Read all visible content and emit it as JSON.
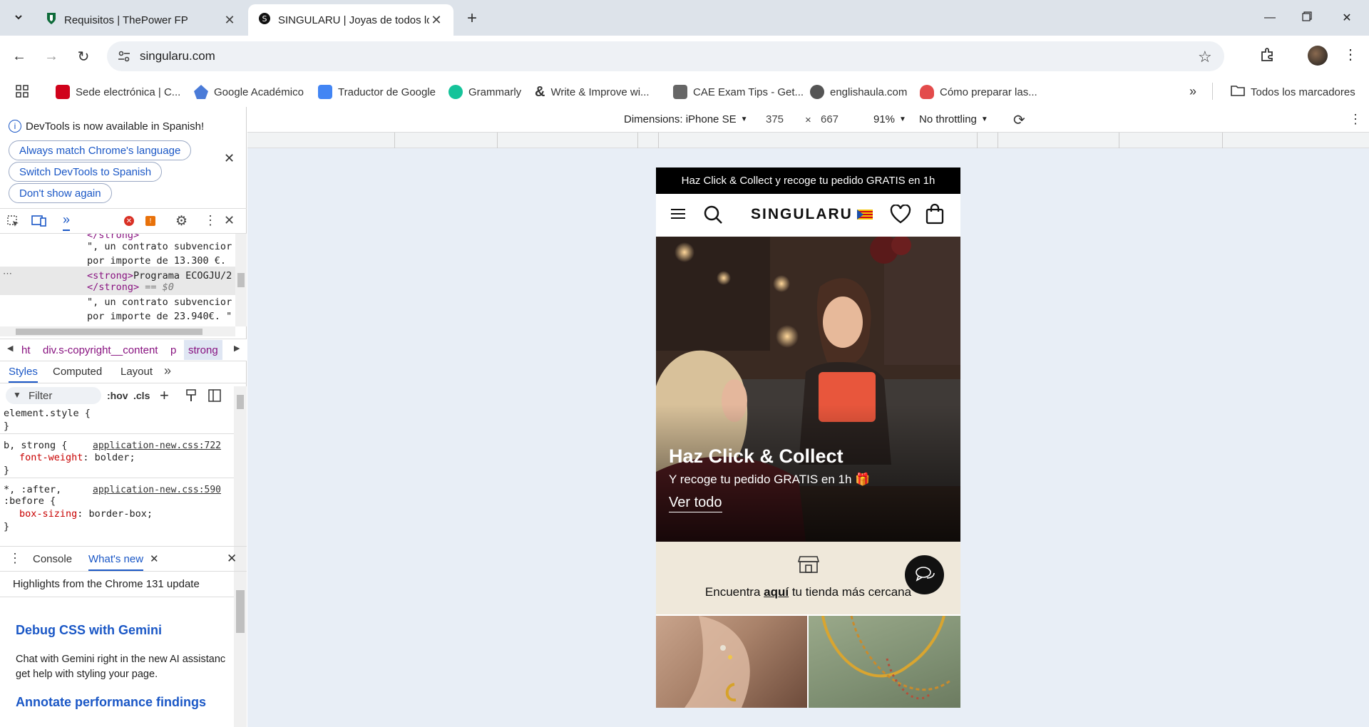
{
  "browser": {
    "tabs": [
      {
        "title": "Requisitos | ThePower FP",
        "active": false
      },
      {
        "title": "SINGULARU | Joyas de todos los estilos",
        "active": true
      }
    ],
    "url": "singularu.com",
    "bookmarks": [
      {
        "label": "Sede electrónica | C...",
        "icon": "madrid-icon",
        "color": "#d0021b"
      },
      {
        "label": "Google Académico",
        "icon": "scholar-icon",
        "color": "#4a7bd8"
      },
      {
        "label": "Traductor de Google",
        "icon": "translate-icon",
        "color": "#4285f4"
      },
      {
        "label": "Grammarly",
        "icon": "grammarly-icon",
        "color": "#15c39a"
      },
      {
        "label": "Write & Improve wi...",
        "icon": "ampersand-icon",
        "color": "#111111"
      },
      {
        "label": "CAE Exam Tips - Get...",
        "icon": "cae-icon",
        "color": "#666666"
      },
      {
        "label": "englishaula.com",
        "icon": "globe-icon",
        "color": "#555555"
      },
      {
        "label": "Cómo preparar las...",
        "icon": "elephant-icon",
        "color": "#e34b4b"
      }
    ],
    "all_bookmarks": "Todos los marcadores"
  },
  "devtools": {
    "notice": "DevTools is now available in Spanish!",
    "btn_match": "Always match Chrome's language",
    "btn_switch": "Switch DevTools to Spanish",
    "btn_dont_show": "Don't show again",
    "code": {
      "l0": "</strong>",
      "l1": "\", un contrato subvencior",
      "l2": "por importe de 13.300 €.",
      "l3_tag": "<strong>",
      "l3_text": "Programa ECOGJU/2",
      "l4_tag": "</strong>",
      "l4_eq": " == $0",
      "l5": "\", un contrato subvencior",
      "l6": "por importe de 23.940€. \""
    },
    "breadcrumbs": [
      "ht",
      "div.s-copyright__content",
      "p",
      "strong"
    ],
    "style_tabs": [
      "Styles",
      "Computed",
      "Layout"
    ],
    "filter_placeholder": "Filter",
    "hov": ":hov",
    "cls": ".cls",
    "rules": {
      "r1_selector": "element.style {",
      "r1_close": "}",
      "r2_selector": "b, strong {",
      "r2_source": "application-new.css:722",
      "r2_prop": "font-weight",
      "r2_val": "bolder;",
      "r2_close": "}",
      "r3_selector_a": "*, :after,",
      "r3_selector_b": ":before {",
      "r3_source": "application-new.css:590",
      "r3_prop": "box-sizing",
      "r3_val": "border-box;",
      "r3_close": "}"
    },
    "drawer_tabs": [
      "Console",
      "What's new"
    ],
    "whatsnew_header": "Highlights from the Chrome 131 update",
    "article1_title": "Debug CSS with Gemini",
    "article1_body_1": "Chat with Gemini right in the new AI assistanc",
    "article1_body_2": "get help with styling your page.",
    "article2_title": "Annotate performance findings"
  },
  "device_toolbar": {
    "dimensions": "Dimensions: iPhone SE",
    "width": "375",
    "times": "×",
    "height": "667",
    "zoom": "91%",
    "throttling": "No throttling"
  },
  "site": {
    "promo": "Haz Click & Collect y recoge tu pedido GRATIS en 1h",
    "brand": "SINGULARU",
    "hero_title": "Haz Click & Collect",
    "hero_subtitle": "Y recoge tu pedido GRATIS en 1h 🎁",
    "hero_cta": "Ver todo",
    "store_pre": "Encuentra ",
    "store_link": "aquí",
    "store_post": " tu tienda más cercana"
  },
  "colors": {
    "accent": "#1a57c6",
    "promo_bg": "#000000",
    "store_bg": "#efe8da"
  }
}
